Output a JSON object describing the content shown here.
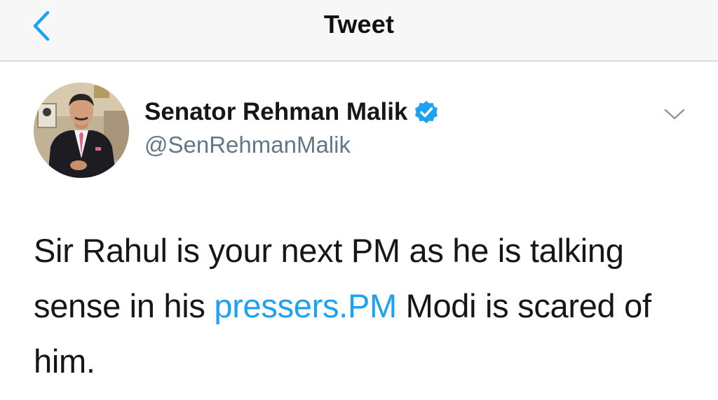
{
  "header": {
    "title": "Tweet",
    "back_icon": "chevron-left-icon"
  },
  "tweet": {
    "author": {
      "display_name": "Senator Rehman Malik",
      "handle": "@SenRehmanMalik",
      "verified": true,
      "verified_icon": "verified-badge-icon"
    },
    "menu_icon": "chevron-down-icon",
    "text_before_link": "Sir Rahul is your next PM as he is talking sense in his ",
    "link_text": "pressers.PM",
    "text_after_link": " Modi is scared of him."
  },
  "colors": {
    "accent": "#1da1f2",
    "text": "#14171a",
    "secondary_text": "#657786",
    "nav_background": "#f7f7f7"
  }
}
